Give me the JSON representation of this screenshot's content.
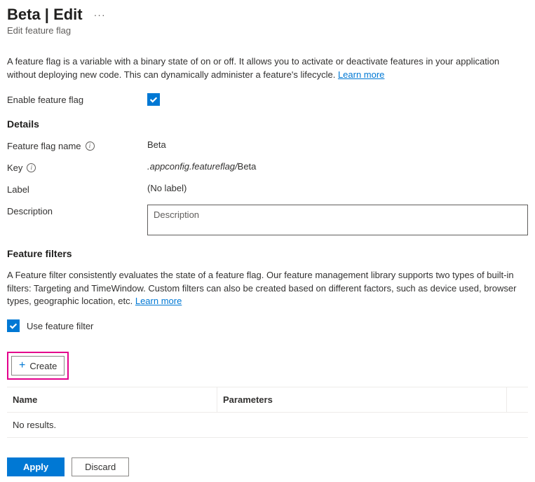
{
  "header": {
    "title": "Beta | Edit",
    "subtitle": "Edit feature flag"
  },
  "intro": {
    "text": "A feature flag is a variable with a binary state of on or off. It allows you to activate or deactivate features in your application without deploying new code. This can dynamically administer a feature's lifecycle. ",
    "learn_more": "Learn more"
  },
  "enable": {
    "label": "Enable feature flag",
    "checked": true
  },
  "section_details": "Details",
  "details": {
    "name_label": "Feature flag name",
    "name_value": "Beta",
    "key_label": "Key",
    "key_prefix": ".appconfig.featureflag/",
    "key_value": "Beta",
    "label_label": "Label",
    "label_value": "(No label)",
    "description_label": "Description",
    "description_placeholder": "Description",
    "description_value": ""
  },
  "section_filters": "Feature filters",
  "filters": {
    "intro": "A Feature filter consistently evaluates the state of a feature flag. Our feature management library supports two types of built-in filters: Targeting and TimeWindow. Custom filters can also be created based on different factors, such as device used, browser types, geographic location, etc. ",
    "learn_more": "Learn more",
    "use_filter_label": "Use feature filter",
    "use_filter_checked": true,
    "create_label": "Create",
    "table": {
      "col_name": "Name",
      "col_params": "Parameters",
      "empty": "No results."
    }
  },
  "actions": {
    "apply": "Apply",
    "discard": "Discard"
  }
}
